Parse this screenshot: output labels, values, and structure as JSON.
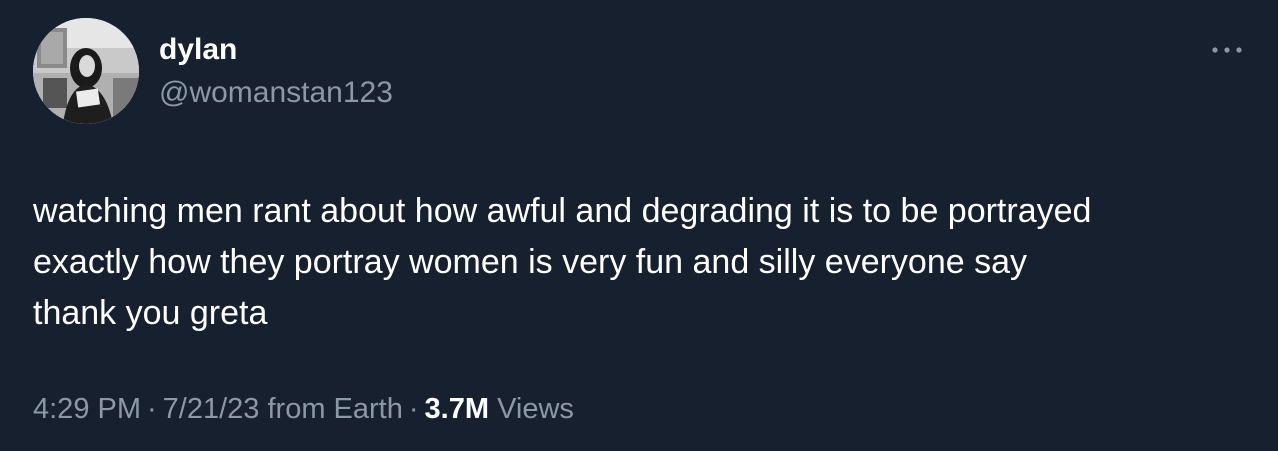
{
  "user": {
    "display_name": "dylan",
    "handle": "@womanstan123",
    "avatar_icon": "profile-photo"
  },
  "tweet": {
    "text": "watching men rant about how awful and degrading it is to be portrayed\nexactly how they portray women is very fun and silly everyone say\nthank you greta"
  },
  "meta": {
    "time": "4:29 PM",
    "separator": "·",
    "date": "7/21/23",
    "source": "from Earth",
    "views_count": "3.7M",
    "views_label": "Views"
  },
  "icons": {
    "more": "more-options-icon"
  },
  "colors": {
    "background": "#16202e",
    "primary_text": "#ffffff",
    "secondary_text": "#8b98a5"
  }
}
